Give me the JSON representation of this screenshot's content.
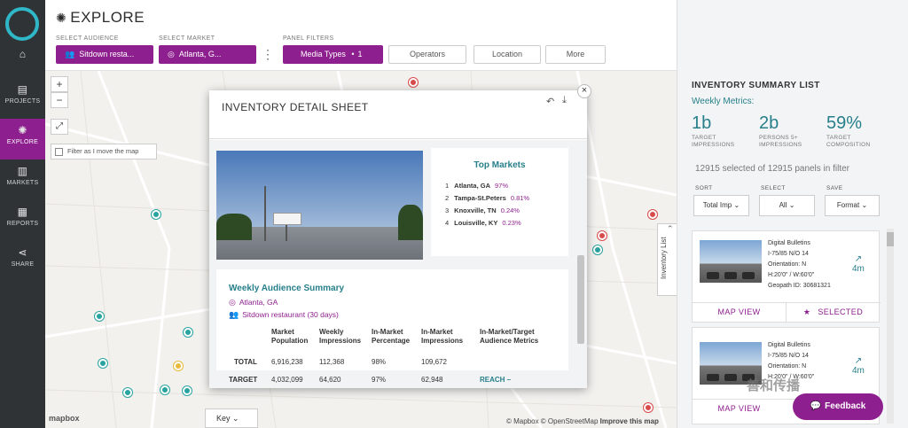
{
  "sidebar": {
    "items": [
      {
        "label": "",
        "icon": "home-icon"
      },
      {
        "label": "PROJECTS",
        "icon": "projects-icon"
      },
      {
        "label": "EXPLORE",
        "icon": "explore-icon"
      },
      {
        "label": "MARKETS",
        "icon": "markets-icon"
      },
      {
        "label": "REPORTS",
        "icon": "reports-icon"
      },
      {
        "label": "SHARE",
        "icon": "share-icon"
      }
    ]
  },
  "header": {
    "title": "EXPLORE",
    "audience_label": "SELECT AUDIENCE",
    "audience_value": "Sitdown resta...",
    "market_label": "SELECT MARKET",
    "market_value": "Atlanta, G...",
    "filters_label": "PANEL FILTERS",
    "media_types": "Media Types",
    "media_count": "1",
    "operators": "Operators",
    "location": "Location",
    "more": "More"
  },
  "map": {
    "zoom_in": "+",
    "zoom_out": "−",
    "filter_move": "Filter as I move the map",
    "logo": "mapbox",
    "attribution": "© Mapbox © OpenStreetMap",
    "improve": "Improve this map",
    "key": "Key",
    "inventory_tab": "Inventory List"
  },
  "modal": {
    "title": "INVENTORY DETAIL SHEET",
    "top_markets": {
      "title": "Top Markets",
      "rows": [
        {
          "rank": "1",
          "name": "Atlanta, GA",
          "pct": "97%"
        },
        {
          "rank": "2",
          "name": "Tampa-St.Peters",
          "pct": "0.81%"
        },
        {
          "rank": "3",
          "name": "Knoxville, TN",
          "pct": "0.24%"
        },
        {
          "rank": "4",
          "name": "Louisville, KY",
          "pct": "0.23%"
        }
      ]
    },
    "audience": {
      "title": "Weekly Audience Summary",
      "market": "Atlanta, GA",
      "audience": "Sitdown restaurant (30 days)",
      "headers": [
        "Market Population",
        "Weekly Impressions",
        "In-Market Percentage",
        "In-Market Impressions",
        "In-Market/Target Audience Metrics"
      ],
      "rows": [
        {
          "label": "TOTAL",
          "values": [
            "6,916,238",
            "112,368",
            "98%",
            "109,672",
            ""
          ]
        },
        {
          "label": "TARGET",
          "values": [
            "4,032,099",
            "64,620",
            "97%",
            "62,948",
            "REACH –"
          ]
        }
      ]
    }
  },
  "summary": {
    "title": "INVENTORY SUMMARY LIST",
    "weekly": "Weekly Metrics:",
    "metrics": [
      {
        "value": "1b",
        "label": "TARGET IMPRESSIONS"
      },
      {
        "value": "2b",
        "label": "PERSONS 5+ IMPRESSIONS"
      },
      {
        "value": "59%",
        "label": "TARGET COMPOSITION"
      }
    ],
    "count": "12915 selected of 12915 panels in filter",
    "sort_label": "SORT",
    "sort_value": "Total Imp",
    "select_label": "SELECT",
    "select_value": "All",
    "save_label": "SAVE",
    "save_value": "Format",
    "cards": [
      {
        "type": "Digital Bulletins",
        "road": "I-75/85 N/O 14",
        "orient": "Orientation: N",
        "size": "H:20'0\" / W:60'0\"",
        "geopath": "Geopath ID: 30681321",
        "trend": "4m",
        "map_view": "MAP VIEW",
        "selected": "SELECTED"
      },
      {
        "type": "Digital Bulletins",
        "road": "I-75/85 N/O 14",
        "orient": "Orientation: N",
        "size": "H:20'0\" / W:60'0\"",
        "trend": "4m",
        "map_view": "MAP VIEW"
      }
    ],
    "feedback": "Feedback",
    "watermark": "善和传播"
  }
}
